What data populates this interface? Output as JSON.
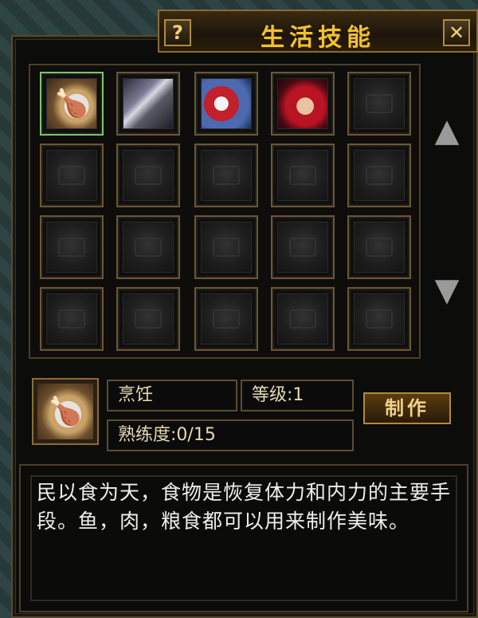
{
  "window": {
    "title": "生活技能",
    "help_label": "?",
    "close_label": "✕"
  },
  "grid": {
    "items": [
      {
        "icon": "roast-chicken-icon",
        "glyph": "🍗",
        "selected": true
      },
      {
        "icon": "anvil-icon",
        "glyph": ""
      },
      {
        "icon": "scroll-icon",
        "glyph": ""
      },
      {
        "icon": "crafting-hands-icon",
        "glyph": ""
      }
    ],
    "scroll_up": "▲",
    "scroll_down": "▼"
  },
  "skill": {
    "name": "烹饪",
    "level": "等级:1",
    "proficiency": "熟练度:0/15",
    "make_label": "制作"
  },
  "description": "民以食为天，食物是恢复体力和内力的主要手段。鱼，肉，粮食都可以用来制作美味。",
  "colors": {
    "title": "#f2c12e",
    "selected_border": "#7ec46b",
    "frame": "#8a6c34"
  }
}
